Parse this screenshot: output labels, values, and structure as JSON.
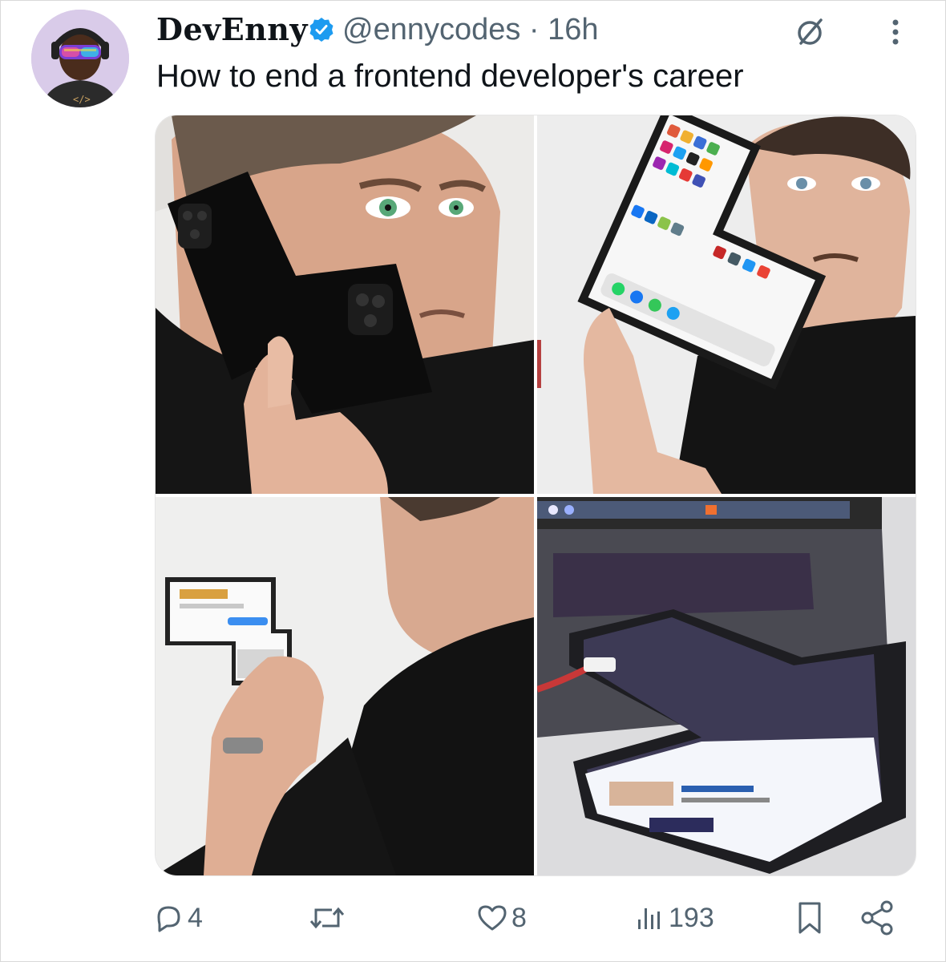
{
  "tweet": {
    "display_name": "DevEnny",
    "handle_time": "@ennycodes · 16h",
    "text": "How to end a frontend developer's career",
    "verified": true
  },
  "media": {
    "images": [
      "man-holding-L-shaped-phone-to-ear",
      "man-holding-L-shaped-phone-showing-app-grid",
      "man-typing-on-L-shaped-phone",
      "L-shaped-phone-charging-next-to-laptop"
    ]
  },
  "actions": {
    "replies": "4",
    "reposts": "",
    "likes": "8",
    "views": "193"
  },
  "icons": {
    "verified": "verified-badge-icon",
    "grok": "grok-icon",
    "more": "more-vertical-icon",
    "reply": "reply-icon",
    "repost": "repost-icon",
    "like": "heart-icon",
    "views": "views-icon",
    "bookmark": "bookmark-icon",
    "share": "share-icon"
  },
  "colors": {
    "text": "#0f1419",
    "secondary": "#536471",
    "verified": "#1d9bf0"
  }
}
